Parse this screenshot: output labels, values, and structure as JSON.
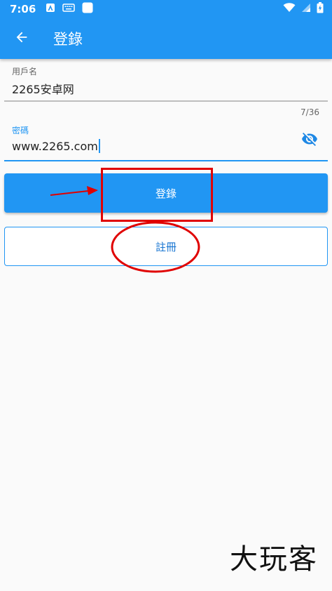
{
  "status_bar": {
    "time": "7:06"
  },
  "toolbar": {
    "title": "登錄",
    "back_icon": "arrow-back-icon"
  },
  "form": {
    "username": {
      "label": "用戶名",
      "value": "2265安卓网"
    },
    "counter": "7/36",
    "password": {
      "label": "密碼",
      "value": "www.2265.com",
      "toggle_icon": "eye-off-icon"
    }
  },
  "buttons": {
    "login_label": "登錄",
    "register_label": "註冊"
  },
  "watermark": "大玩客",
  "colors": {
    "primary": "#2196f3",
    "annotation": "#e00000"
  }
}
